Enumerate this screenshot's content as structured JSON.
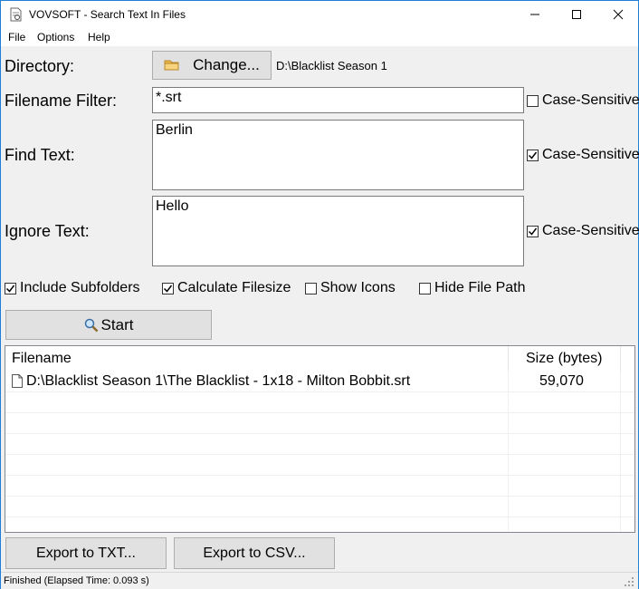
{
  "window": {
    "title": "VOVSOFT - Search Text In Files",
    "minimize_icon": "minimize-icon",
    "maximize_icon": "maximize-icon",
    "close_icon": "close-icon"
  },
  "menu": [
    "File",
    "Options",
    "Help"
  ],
  "form": {
    "directory_label": "Directory:",
    "change_button": "Change...",
    "directory_path": "D:\\Blacklist Season 1",
    "filename_filter_label": "Filename Filter:",
    "filename_filter_value": "*.srt",
    "find_text_label": "Find Text:",
    "find_text_value": "Berlin",
    "ignore_text_label": "Ignore Text:",
    "ignore_text_value": "Hello",
    "case_sensitive_label": "Case-Sensitive",
    "case_filter_checked": false,
    "case_find_checked": true,
    "case_ignore_checked": true
  },
  "options": [
    {
      "label": "Include Subfolders",
      "checked": true
    },
    {
      "label": "Calculate Filesize",
      "checked": true
    },
    {
      "label": "Show Icons",
      "checked": false
    },
    {
      "label": "Hide File Path",
      "checked": false
    }
  ],
  "start_button": "Start",
  "results": {
    "columns": [
      "Filename",
      "Size (bytes)"
    ],
    "rows": [
      {
        "filename": "D:\\Blacklist Season 1\\The Blacklist - 1x18 - Milton Bobbit.srt",
        "size": "59,070"
      }
    ]
  },
  "export": {
    "txt": "Export to TXT...",
    "csv": "Export to CSV..."
  },
  "status": "Finished (Elapsed Time: 0.093 s)",
  "colors": {
    "window_border": "#1e7fd8",
    "folder": "#e8b94a",
    "face": "#f0f0f0"
  }
}
